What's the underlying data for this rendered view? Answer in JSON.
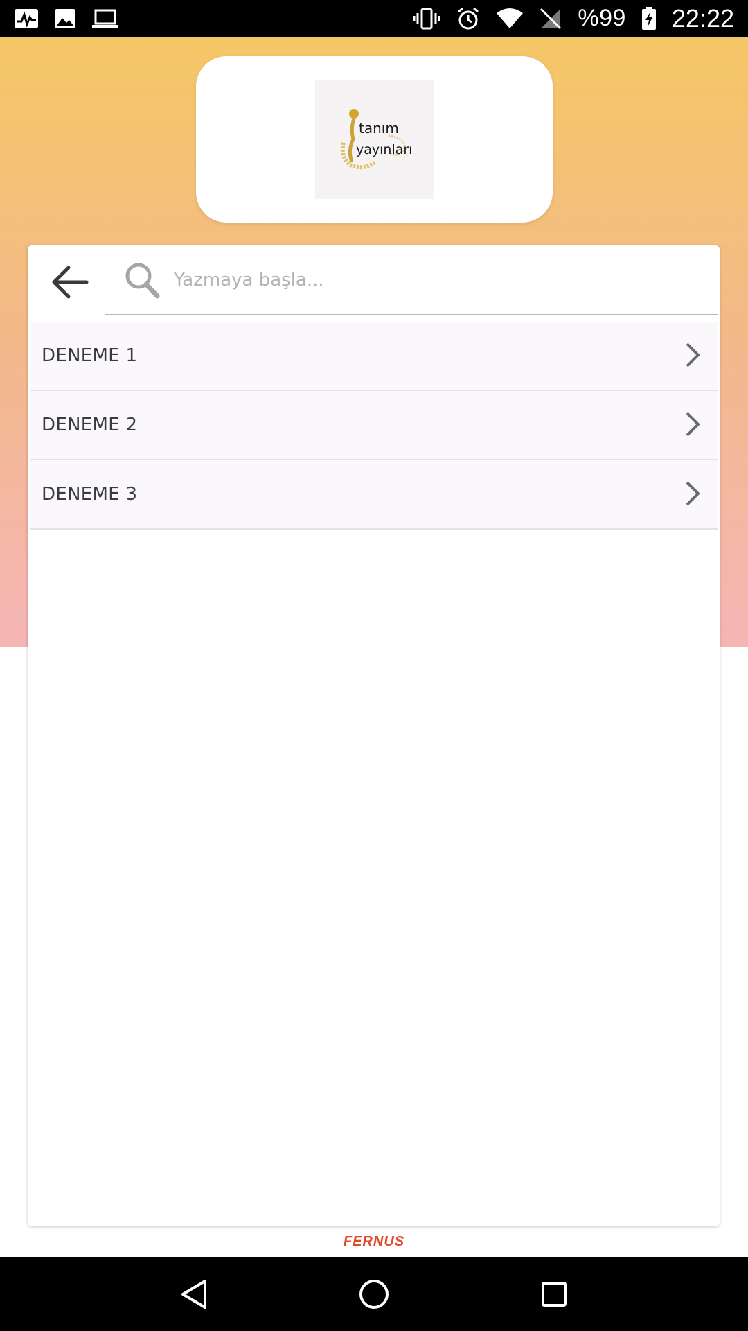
{
  "status_bar": {
    "battery_text": "%99",
    "time": "22:22",
    "left_icons": [
      "activity-icon",
      "image-icon",
      "laptop-icon"
    ],
    "right_icons": [
      "vibrate-icon",
      "alarm-icon",
      "wifi-icon",
      "no-sim-icon",
      "battery-charging-icon"
    ]
  },
  "logo": {
    "text_line1": "tanım",
    "text_line2": "yayınları"
  },
  "search": {
    "placeholder": "Yazmaya başla...",
    "value": ""
  },
  "list": {
    "items": [
      {
        "label": "DENEME 1"
      },
      {
        "label": "DENEME 2"
      },
      {
        "label": "DENEME 3"
      }
    ]
  },
  "footer": {
    "brand": "FERNUS"
  },
  "colors": {
    "gradient_top": "#f4c766",
    "gradient_bottom": "#f4b5b5",
    "brand_red": "#e2472c",
    "list_bg": "#faf8fa"
  }
}
